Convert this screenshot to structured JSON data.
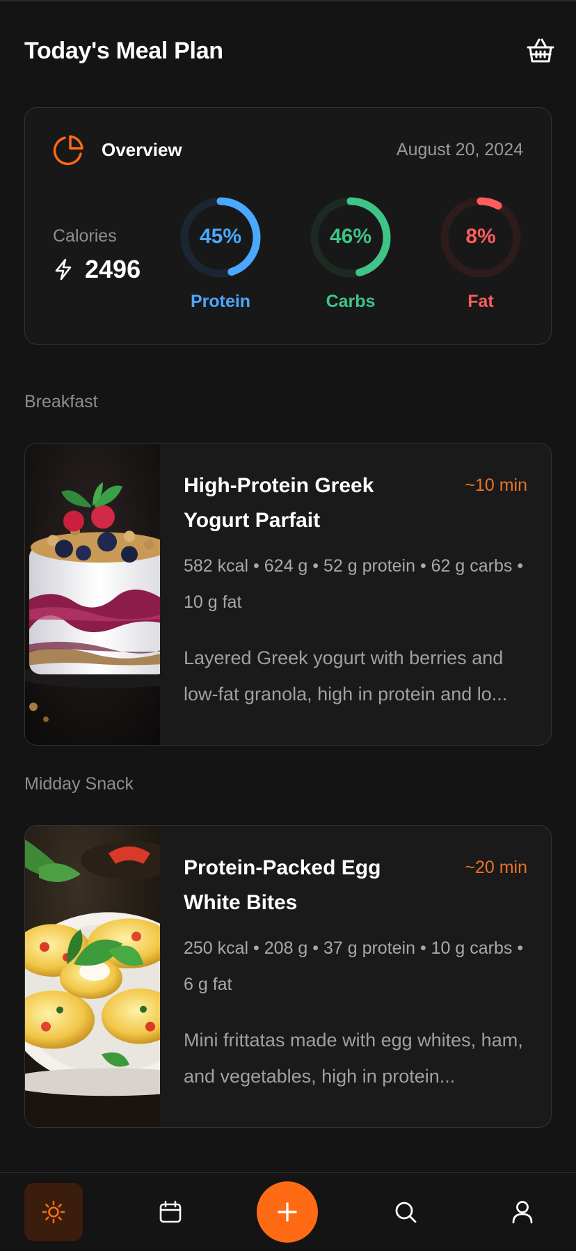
{
  "header": {
    "title": "Today's Meal Plan",
    "basket_icon": "basket-icon"
  },
  "overview": {
    "title": "Overview",
    "date": "August 20, 2024",
    "icon": "pie-chart-icon",
    "calories_label": "Calories",
    "calories_value": "2496",
    "macros": [
      {
        "label": "Protein",
        "percent": "45%",
        "fraction": 0.45,
        "color": "#4aa8ff",
        "track": "#1c2633"
      },
      {
        "label": "Carbs",
        "percent": "46%",
        "fraction": 0.46,
        "color": "#3ec487",
        "track": "#1c2a22"
      },
      {
        "label": "Fat",
        "percent": "8%",
        "fraction": 0.08,
        "color": "#ff5c5c",
        "track": "#2e1c1c"
      }
    ]
  },
  "sections": [
    {
      "label": "Breakfast",
      "meal": {
        "title": "High-Protein Greek Yogurt Parfait",
        "time": "~10 min",
        "stats": "582 kcal • 624 g • 52 g protein • 62 g carbs • 10 g fat",
        "description": "Layered Greek yogurt with berries and low-fat granola, high in protein and lo..."
      }
    },
    {
      "label": "Midday Snack",
      "meal": {
        "title": "Protein-Packed Egg White Bites",
        "time": "~20 min",
        "stats": "250 kcal • 208 g • 37 g protein • 10 g carbs • 6 g fat",
        "description": "Mini frittatas made with egg whites, ham, and vegetables, high in protein..."
      }
    }
  ],
  "nav": {
    "items": [
      "sun-icon",
      "calendar-icon",
      "plus-icon",
      "search-icon",
      "user-icon"
    ],
    "active": "sun-icon"
  },
  "colors": {
    "accent": "#ff6a14",
    "background": "#141414"
  }
}
